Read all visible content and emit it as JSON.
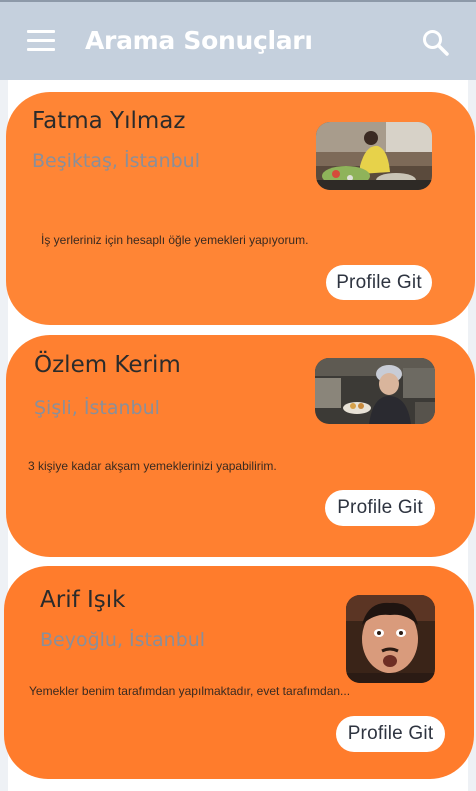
{
  "header": {
    "title": "Arama Sonuçları",
    "menu_icon": "hamburger-menu-icon",
    "search_icon": "search-icon",
    "background_color": "#c5d0dd"
  },
  "results": [
    {
      "name": "Fatma Yılmaz",
      "location": "Beşiktaş, İstanbul",
      "description": "İş yerleriniz için hesaplı öğle yemekleri yapıyorum.",
      "button_label": "Profile Git"
    },
    {
      "name": "Özlem Kerim",
      "location": "Şişli, İstanbul",
      "description": "3 kişiye  kadar akşam yemeklerinizi yapabilirim.",
      "button_label": "Profile Git"
    },
    {
      "name": "Arif Işık",
      "location": "Beyoğlu, İstanbul",
      "description": "Yemekler benim tarafımdan yapılmaktadır, evet tarafımdan...",
      "button_label": "Profile Git"
    }
  ],
  "colors": {
    "card": "#ff8030",
    "button": "#ffffff",
    "location_text": "#8a8f9a"
  }
}
